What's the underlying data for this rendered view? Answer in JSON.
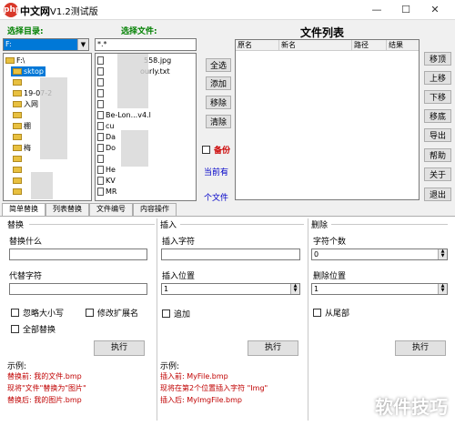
{
  "titlebar": {
    "logo_text": "php",
    "site_text": "中文网",
    "title": "V1.2测试版",
    "minimize": "—",
    "maximize": "☐",
    "close": "✕"
  },
  "left_panel": {
    "dir_label": "选择目录:",
    "drive": "F:",
    "tree_root": "F:\\",
    "tree_selected": "sktop",
    "tree_items": [
      "19-07-2",
      "入网",
      "棚",
      "梅"
    ]
  },
  "file_panel": {
    "label": "选择文件:",
    "filter": "*.*",
    "files": [
      "558.jpg",
      "ourly.txt",
      "Be",
      "cu",
      "Da",
      "Do",
      "He",
      "KV",
      "MR"
    ],
    "file_suffix_1": "-Lon...v4.l"
  },
  "middle": {
    "buttons": [
      "全选",
      "添加",
      "移除",
      "清除"
    ],
    "backup_label": "备份",
    "current_label": "当前有",
    "count_label": "个文件"
  },
  "file_list": {
    "title": "文件列表",
    "columns": [
      "原名",
      "新名",
      "路径",
      "结果"
    ]
  },
  "right_buttons": [
    "移顶",
    "上移",
    "下移",
    "移底",
    "导出",
    "帮助",
    "关于",
    "退出"
  ],
  "tabs": [
    "简单替换",
    "列表替换",
    "文件编号",
    "内容操作"
  ],
  "replace_group": {
    "title": "替换",
    "find_label": "替换什么",
    "replace_label": "代替字符",
    "ignore_case": "忽略大小写",
    "modify_ext": "修改扩展名",
    "replace_all": "全部替换",
    "exec": "执行",
    "example_title": "示例:",
    "example_1": "替换前: 我的文件.bmp",
    "example_2": "现将\"文件\"替换为\"图片\"",
    "example_3": "替换后: 我的图片.bmp"
  },
  "insert_group": {
    "title": "插入",
    "char_label": "插入字符",
    "pos_label": "插入位置",
    "pos_value": "1",
    "append": "追加",
    "exec": "执行",
    "example_title": "示例:",
    "example_1": "插入前: MyFile.bmp",
    "example_2": "现将在第2个位置插入字符 \"Img\"",
    "example_3": "插入后: MyImgFile.bmp"
  },
  "delete_group": {
    "title": "删除",
    "count_label": "字符个数",
    "count_value": "0",
    "pos_label": "删除位置",
    "pos_value": "1",
    "from_end": "从尾部",
    "exec": "执行"
  },
  "watermark": "软件技巧"
}
